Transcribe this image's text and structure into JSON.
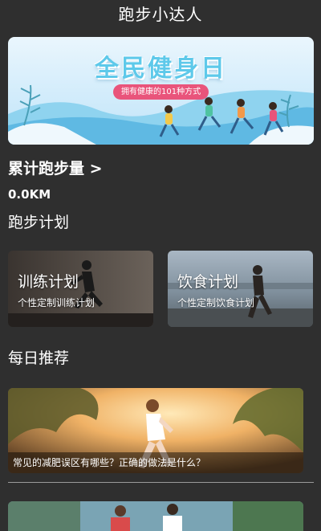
{
  "app": {
    "title": "跑步小达人"
  },
  "banner": {
    "title": "全民健身日",
    "subtitle": "拥有健康的101种方式"
  },
  "stats": {
    "total_label": "累计跑步量 >",
    "distance": "0.0KM"
  },
  "plans": {
    "section_title": "跑步计划",
    "items": [
      {
        "title": "训练计划",
        "subtitle": "个性定制训练计划"
      },
      {
        "title": "饮食计划",
        "subtitle": "个性定制饮食计划"
      }
    ]
  },
  "recommend": {
    "section_title": "每日推荐",
    "items": [
      {
        "caption": "常见的减肥误区有哪些？正确的做法是什么？"
      }
    ]
  },
  "colors": {
    "background": "#2f2f2f",
    "banner_accent": "#5ec9ea",
    "banner_pill": "#e9547b"
  }
}
